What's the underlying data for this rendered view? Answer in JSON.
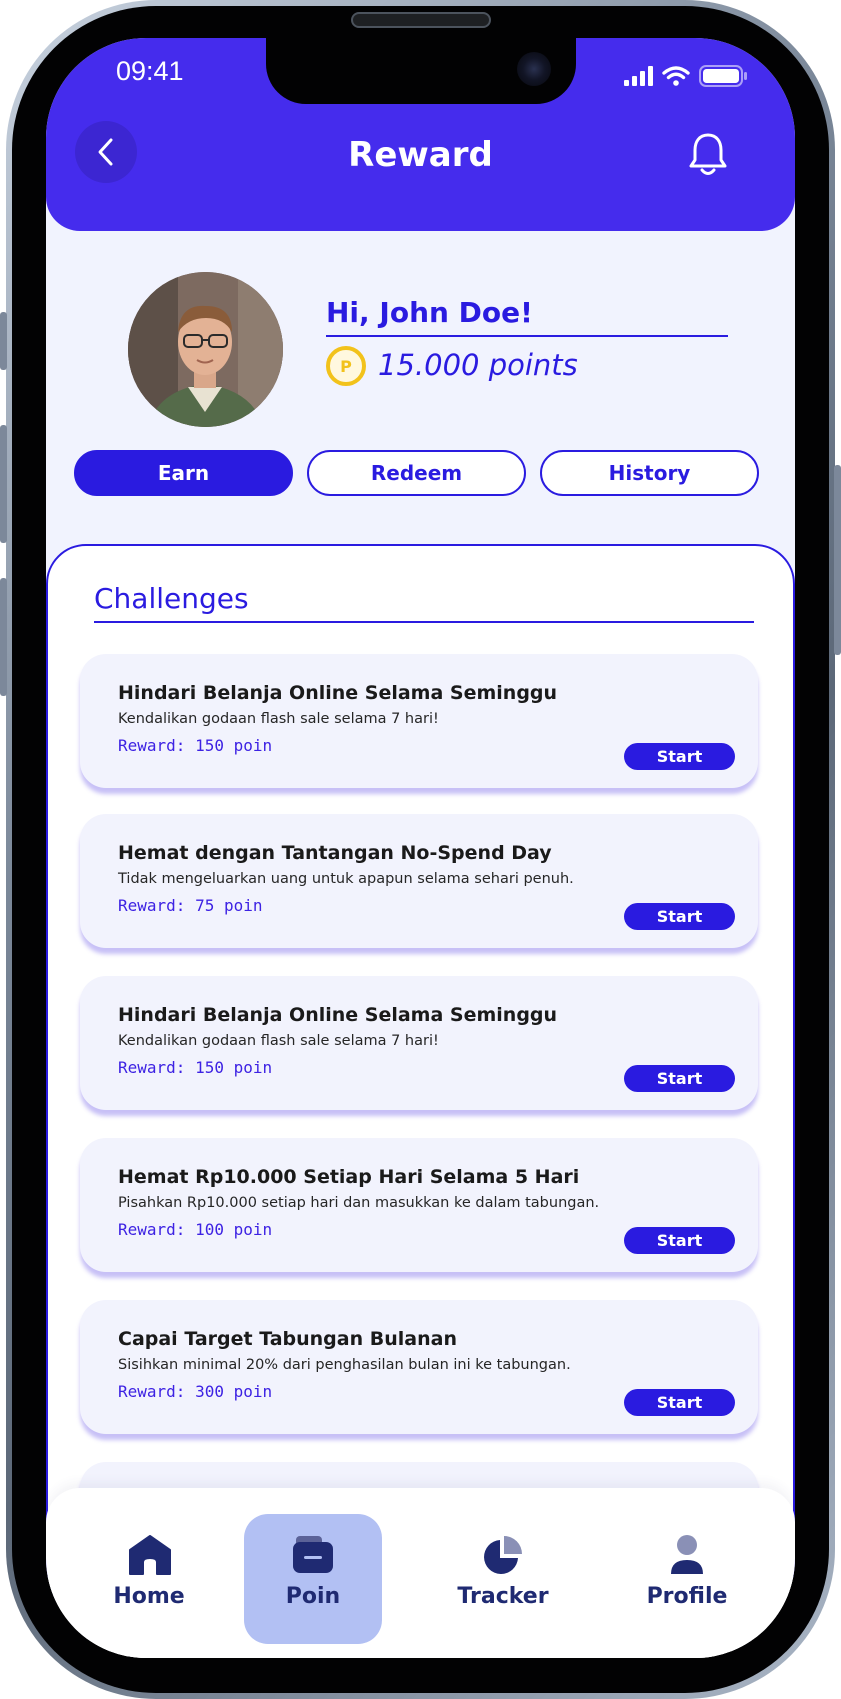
{
  "status_bar": {
    "time": "09:41"
  },
  "header": {
    "title": "Reward"
  },
  "profile": {
    "greeting": "Hi, John Doe!",
    "coin_symbol": "P",
    "points": "15.000 points"
  },
  "tabs": [
    {
      "label": "Earn",
      "active": true
    },
    {
      "label": "Redeem",
      "active": false
    },
    {
      "label": "History",
      "active": false
    }
  ],
  "challenges": {
    "section_title": "Challenges",
    "items": [
      {
        "title": "Hindari Belanja Online Selama Seminggu",
        "description": "Kendalikan godaan flash sale selama 7 hari!",
        "reward": "Reward: 150 poin",
        "button": "Start"
      },
      {
        "title": "Hemat dengan Tantangan No-Spend Day",
        "description": "Tidak mengeluarkan uang untuk apapun selama sehari penuh.",
        "reward": "Reward: 75 poin",
        "button": "Start"
      },
      {
        "title": "Hindari Belanja Online Selama Seminggu",
        "description": "Kendalikan godaan flash sale selama 7 hari!",
        "reward": "Reward: 150 poin",
        "button": "Start"
      },
      {
        "title": "Hemat Rp10.000 Setiap Hari Selama 5 Hari",
        "description": "Pisahkan Rp10.000 setiap hari dan masukkan ke dalam tabungan.",
        "reward": "Reward: 100 poin",
        "button": "Start"
      },
      {
        "title": "Capai Target Tabungan Bulanan",
        "description": "Sisihkan minimal 20% dari penghasilan bulan ini ke tabungan.",
        "reward": "Reward: 300 poin",
        "button": "Start"
      }
    ]
  },
  "bottom_nav": [
    {
      "label": "Home",
      "icon": "home-icon",
      "active": false
    },
    {
      "label": "Poin",
      "icon": "wallet-icon",
      "active": true
    },
    {
      "label": "Tracker",
      "icon": "pie-chart-icon",
      "active": false
    },
    {
      "label": "Profile",
      "icon": "user-icon",
      "active": false
    }
  ],
  "colors": {
    "primary": "#452ced",
    "accent": "#2a1be0",
    "screen_bg": "#f1f3fe",
    "coin": "#f2c21b",
    "nav_active_bg": "#b2c0f3",
    "nav_text": "#1f2a72"
  }
}
